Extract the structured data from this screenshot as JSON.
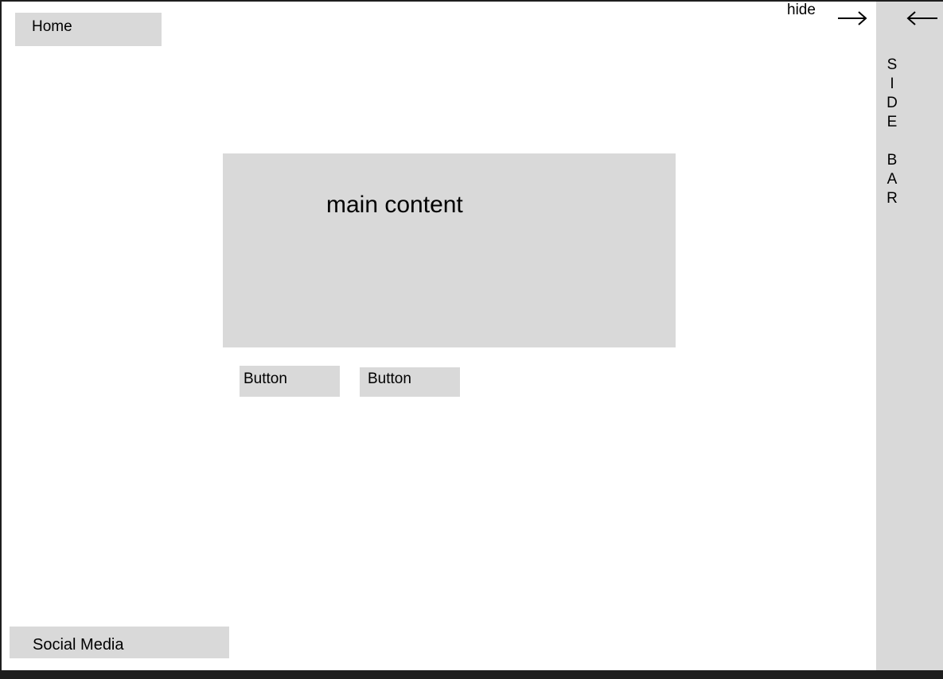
{
  "nav": {
    "home_label": "Home"
  },
  "main": {
    "content_label": "main content"
  },
  "buttons": {
    "button1_label": "Button",
    "button2_label": "Button"
  },
  "footer": {
    "social_label": "Social Media"
  },
  "sidebar": {
    "hide_label": "hide",
    "title_letters": [
      "S",
      "I",
      "D",
      "E",
      "",
      "B",
      "A",
      "R"
    ],
    "collapse_icon": "arrow-right-icon",
    "expand_icon": "arrow-left-icon"
  },
  "colors": {
    "panel": "#d9d9d9",
    "background": "#ffffff",
    "border": "#1e1e1e"
  }
}
